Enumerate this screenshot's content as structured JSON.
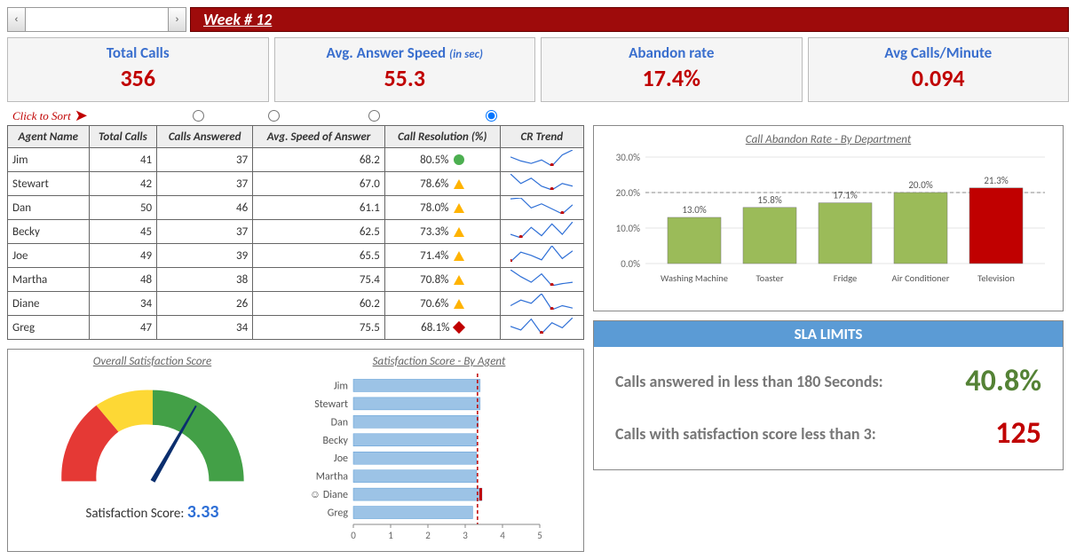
{
  "header": {
    "week_label": "Week # 12"
  },
  "kpis": [
    {
      "title": "Total Calls",
      "sub": "",
      "value": "356",
      "title_color": "blue"
    },
    {
      "title": "Avg. Answer Speed",
      "sub": "(in sec)",
      "value": "55.3",
      "title_color": "blue"
    },
    {
      "title": "Abandon rate",
      "sub": "",
      "value": "17.4%",
      "title_color": "blue"
    },
    {
      "title": "Avg Calls/Minute",
      "sub": "",
      "value": "0.094",
      "title_color": "blue"
    }
  ],
  "sort_hint": "Click to Sort",
  "table": {
    "headers": [
      "Agent Name",
      "Total Calls",
      "Calls Answered",
      "Avg. Speed of Answer",
      "Call Resolution (%)",
      "CR Trend"
    ],
    "rows": [
      {
        "name": "Jim",
        "calls": 41,
        "answered": 37,
        "speed": "68.2",
        "res": "80.5%",
        "icon": "g",
        "spark": [
          68,
          60,
          55,
          62,
          50,
          72,
          82
        ]
      },
      {
        "name": "Stewart",
        "calls": 42,
        "answered": 37,
        "speed": "67.0",
        "res": "78.6%",
        "icon": "y",
        "spark": [
          78,
          60,
          70,
          55,
          48,
          60,
          55
        ]
      },
      {
        "name": "Dan",
        "calls": 50,
        "answered": 46,
        "speed": "61.1",
        "res": "78.0%",
        "icon": "y",
        "spark": [
          80,
          82,
          62,
          70,
          60,
          50,
          68
        ]
      },
      {
        "name": "Becky",
        "calls": 45,
        "answered": 37,
        "speed": "62.5",
        "res": "73.3%",
        "icon": "y",
        "spark": [
          60,
          55,
          70,
          58,
          75,
          60,
          78
        ]
      },
      {
        "name": "Joe",
        "calls": 49,
        "answered": 39,
        "speed": "65.5",
        "res": "71.4%",
        "icon": "y",
        "spark": [
          55,
          70,
          65,
          58,
          80,
          60,
          72
        ]
      },
      {
        "name": "Martha",
        "calls": 48,
        "answered": 38,
        "speed": "75.4",
        "res": "70.8%",
        "icon": "y",
        "spark": [
          78,
          68,
          60,
          72,
          55,
          58,
          60
        ]
      },
      {
        "name": "Diane",
        "calls": 34,
        "answered": 26,
        "speed": "60.2",
        "res": "70.6%",
        "icon": "y",
        "spark": [
          55,
          62,
          58,
          70,
          50,
          55,
          52
        ]
      },
      {
        "name": "Greg",
        "calls": 47,
        "answered": 34,
        "speed": "75.5",
        "res": "68.1%",
        "icon": "r",
        "spark": [
          60,
          55,
          70,
          50,
          65,
          58,
          72
        ]
      }
    ]
  },
  "gauge": {
    "title": "Overall Satisfaction Score",
    "label": "Satisfaction Score:",
    "value": "3.33",
    "max": 5
  },
  "chart_data": [
    {
      "type": "bar",
      "title": "Call Abandon Rate - By Department",
      "categories": [
        "Washing Machine",
        "Toaster",
        "Fridge",
        "Air Conditioner",
        "Television"
      ],
      "values": [
        13.0,
        15.8,
        17.1,
        20.0,
        21.3
      ],
      "highlight_index": 4,
      "ylim": [
        0,
        30
      ],
      "yticks": [
        0,
        10,
        20,
        30
      ],
      "yfmt": "%",
      "target": 20.0
    },
    {
      "type": "hbar",
      "title": "Satisfaction Score - By Agent",
      "categories": [
        "Jim",
        "Stewart",
        "Dan",
        "Becky",
        "Joe",
        "Martha",
        "Diane",
        "Greg"
      ],
      "highlight_index": 6,
      "values": [
        3.4,
        3.4,
        3.35,
        3.3,
        3.3,
        3.3,
        3.45,
        3.2
      ],
      "xlim": [
        0,
        5
      ],
      "xticks": [
        0,
        1,
        2,
        3,
        4,
        5
      ],
      "target": 3.33
    },
    {
      "type": "gauge",
      "title": "Overall Satisfaction Score",
      "value": 3.33,
      "min": 0,
      "max": 5,
      "zones": [
        {
          "to": 2,
          "color": "#e53935"
        },
        {
          "to": 3,
          "color": "#fdd835"
        },
        {
          "to": 5,
          "color": "#43a047"
        }
      ]
    }
  ],
  "sla": {
    "header": "SLA LIMITS",
    "rows": [
      {
        "text": "Calls answered in less than 180 Seconds:",
        "value": "40.8%",
        "cls": "vgreen"
      },
      {
        "text": "Calls with satisfaction score less than 3:",
        "value": "125",
        "cls": "vred"
      }
    ]
  }
}
